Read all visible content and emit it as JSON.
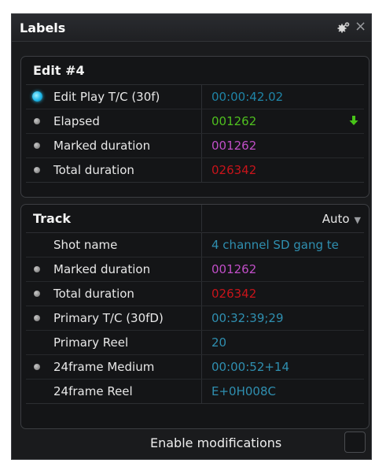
{
  "panel": {
    "title": "Labels"
  },
  "edit": {
    "title": "Edit #4",
    "rows": [
      {
        "label": "Edit Play T/C (30f)",
        "value": "00:00:42.02",
        "color": "#1f84a6",
        "indicator": "active"
      },
      {
        "label": "Elapsed",
        "value": "001262",
        "color": "#4fbf1f",
        "indicator": "dot",
        "arrow": "down-arrow-icon"
      },
      {
        "label": "Marked duration",
        "value": "001262",
        "color": "#c04ec7",
        "indicator": "dot"
      },
      {
        "label": "Total duration",
        "value": "026342",
        "color": "#c8141a",
        "indicator": "dot"
      }
    ]
  },
  "track": {
    "title": "Track",
    "mode": "Auto",
    "rows": [
      {
        "label": "Shot name",
        "value": "4 channel SD gang te",
        "color": "#2f8fb0",
        "indicator": "none"
      },
      {
        "label": "Marked duration",
        "value": "001262",
        "color": "#c04ec7",
        "indicator": "dot"
      },
      {
        "label": "Total duration",
        "value": "026342",
        "color": "#c8141a",
        "indicator": "dot"
      },
      {
        "label": "Primary T/C (30fD)",
        "value": "00:32:39;29",
        "color": "#2f8fb0",
        "indicator": "dot"
      },
      {
        "label": "Primary Reel",
        "value": "20",
        "color": "#2f8fb0",
        "indicator": "none"
      },
      {
        "label": "24frame Medium",
        "value": "00:00:52+14",
        "color": "#2f8fb0",
        "indicator": "dot"
      },
      {
        "label": "24frame Reel",
        "value": "E+0H008C",
        "color": "#2f8fb0",
        "indicator": "none"
      }
    ]
  },
  "footer": {
    "enable_label": "Enable modifications",
    "enable_checked": false
  }
}
